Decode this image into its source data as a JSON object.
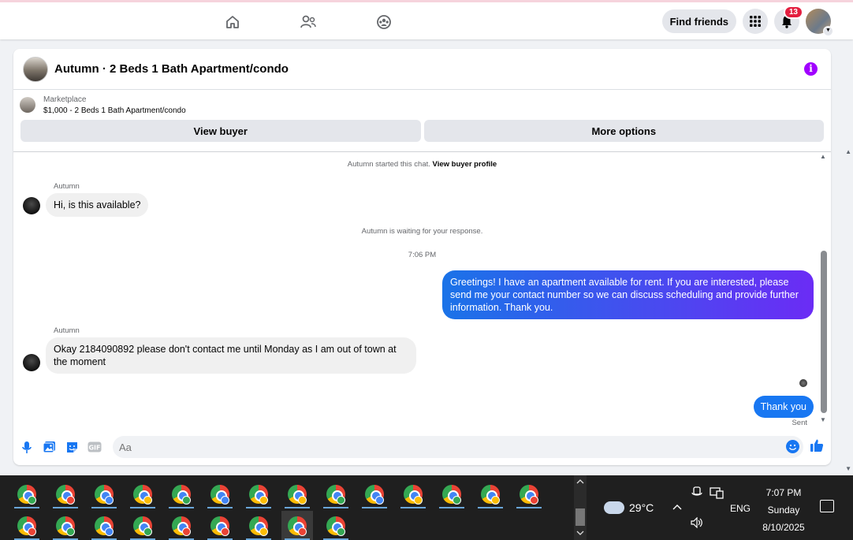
{
  "nav": {
    "find_friends": "Find friends",
    "notification_count": "13",
    "icons": [
      "home-icon",
      "friends-icon",
      "groups-icon",
      "apps-menu-icon",
      "bell-icon"
    ]
  },
  "chat": {
    "title": "Autumn · 2 Beds 1 Bath Apartment/condo",
    "marketplace_label": "Marketplace",
    "listing": "$1,000 - 2 Beds 1 Bath Apartment/condo",
    "view_buyer": "View buyer",
    "more_options": "More options",
    "started_prefix": "Autumn started this chat.",
    "view_buyer_profile": "View buyer profile",
    "sender_name": "Autumn",
    "msg1": "Hi, is this available?",
    "waiting": "Autumn is waiting for your response.",
    "time1": "7:06 PM",
    "msg2": "Greetings! I have an apartment available for rent. If you are interested, please send me your contact number so we can discuss scheduling and provide further information. Thank you.",
    "msg3": "Okay 2184090892 please don't contact me until Monday as I am out of town at the moment",
    "msg4": "Thank you",
    "sent": "Sent",
    "input_placeholder": "Aa"
  },
  "taskbar": {
    "temperature": "29°C",
    "language": "ENG",
    "time": "7:07 PM",
    "day": "Sunday",
    "date": "8/10/2025"
  },
  "colors": {
    "accent": "#1877f2",
    "gradient_end": "#6b2cf5",
    "info": "#a100ff",
    "badge": "#e41e3f"
  }
}
